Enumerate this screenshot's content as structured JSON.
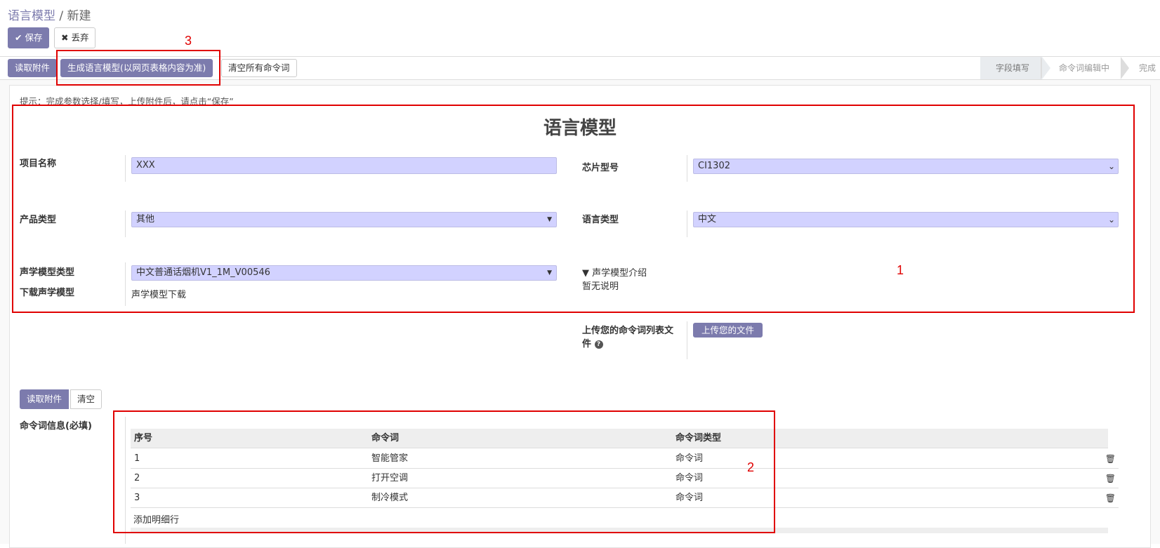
{
  "breadcrumb": {
    "parent": "语言模型",
    "separator": "/",
    "current": "新建"
  },
  "header": {
    "save_label": "保存",
    "discard_label": "丢弃"
  },
  "toolbar": {
    "read_attachment": "读取附件",
    "generate_model": "生成语言模型(以网页表格内容为准)",
    "clear_commands": "清空所有命令词"
  },
  "status_steps": [
    "字段填写",
    "命令词编辑中",
    "完成"
  ],
  "hint": "提示：完成参数选择/填写，上传附件后，请点击“保存”",
  "form": {
    "title": "语言模型",
    "project_name_label": "项目名称",
    "project_name_value": "XXX",
    "chip_model_label": "芯片型号",
    "chip_model_value": "CI1302",
    "product_type_label": "产品类型",
    "product_type_value": "其他",
    "language_type_label": "语言类型",
    "language_type_value": "中文",
    "acoustic_model_label": "声学模型类型",
    "acoustic_model_value": "中文普通话烟机V1_1M_V00546",
    "download_acoustic_label": "下载声学模型",
    "download_acoustic_link": "声学模型下载",
    "acoustic_intro_label": "▼ 声学模型介绍",
    "acoustic_intro_text": "暂无说明",
    "upload_label_line1": "上传您的命令词列表文",
    "upload_label_line2": "件",
    "upload_button": "上传您的文件"
  },
  "commands": {
    "read_attachment": "读取附件",
    "clear": "清空",
    "section_label": "命令词信息(必填)",
    "columns": [
      "序号",
      "命令词",
      "命令词类型"
    ],
    "rows": [
      [
        "1",
        "智能管家",
        "命令词"
      ],
      [
        "2",
        "打开空调",
        "命令词"
      ],
      [
        "3",
        "制冷模式",
        "命令词"
      ]
    ],
    "add_line": "添加明细行"
  },
  "annotations": [
    "1",
    "2",
    "3"
  ],
  "colors": {
    "primary": "#7c7bad",
    "field_bg": "#d2d2ff",
    "annotation": "#e00000"
  }
}
